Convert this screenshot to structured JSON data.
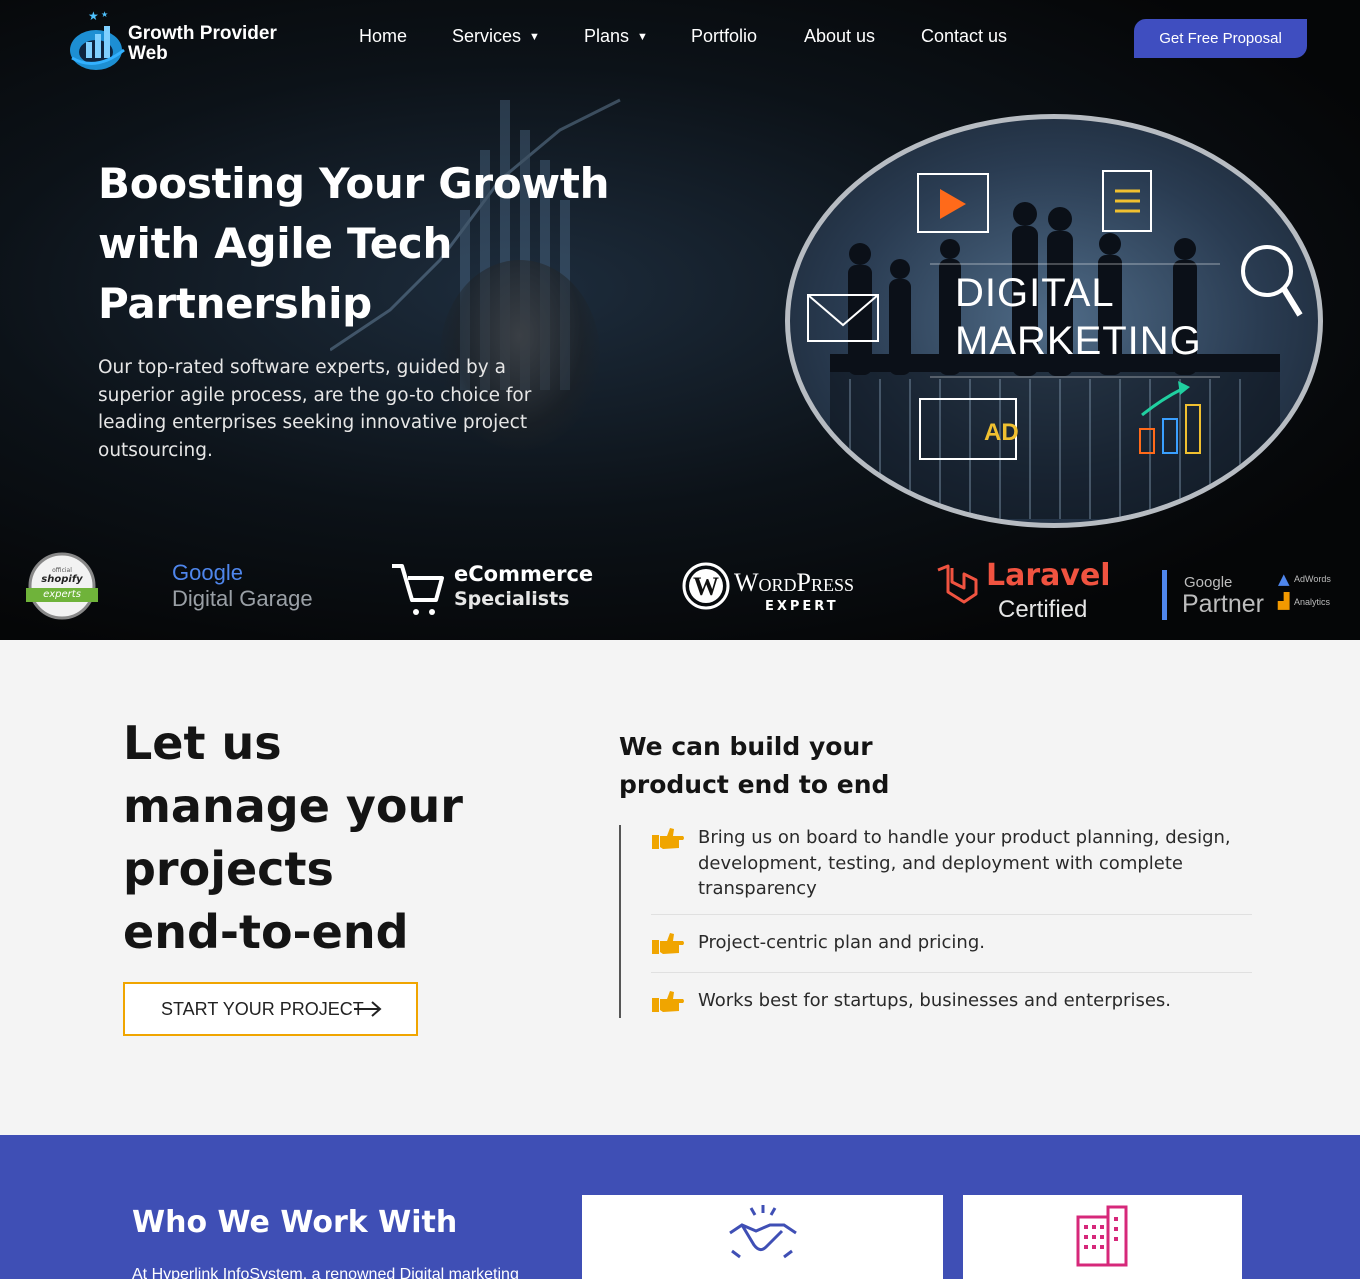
{
  "header": {
    "brand_line1": "Growth Provider",
    "brand_line2": "Web",
    "nav": [
      {
        "label": "Home",
        "has_dropdown": false
      },
      {
        "label": "Services",
        "has_dropdown": true
      },
      {
        "label": "Plans",
        "has_dropdown": true
      },
      {
        "label": "Portfolio",
        "has_dropdown": false
      },
      {
        "label": "About us",
        "has_dropdown": false
      },
      {
        "label": "Contact us",
        "has_dropdown": false
      }
    ],
    "cta_label": "Get Free Proposal",
    "cta_color": "#3f4ec0"
  },
  "hero": {
    "title_line1": "Boosting Your Growth",
    "title_line2": "with Agile Tech",
    "title_line3": "Partnership",
    "subtitle": "Our top-rated software experts, guided by a superior agile process, are the go-to choice for leading enterprises seeking innovative project outsourcing.",
    "graphic": {
      "line1": "DIGITAL",
      "line2": "MARKETING",
      "ad_label": "AD"
    }
  },
  "partners": {
    "shopify_small": "official",
    "shopify_name": "shopify",
    "shopify_ribbon": "experts",
    "google_garage_1": "Google",
    "google_garage_2": "Digital Garage",
    "ecommerce_1": "eCommerce",
    "ecommerce_2": "Specialists",
    "wordpress_1": "WordPress",
    "wordpress_2": "EXPERT",
    "laravel_1": "Laravel",
    "laravel_2": "Certified",
    "gpartner_1": "Google",
    "gpartner_2": "Partner",
    "gpartner_3": "AdWords",
    "gpartner_4": "Analytics"
  },
  "intro": {
    "heading_lines": [
      "Let us",
      "manage your",
      "projects",
      "end-to-end"
    ],
    "button_label": "START YOUR PROJECT",
    "button_border_color": "#f0a500",
    "subheading_line1": "We can build your",
    "subheading_line2": "product end to end",
    "features": [
      "Bring us on board to handle your product planning, design, development, testing, and deployment with complete transparency",
      "Project-centric plan and pricing.",
      "Works best for startups, businesses and enterprises."
    ],
    "feature_icon": "pointing-hand-icon",
    "feature_icon_color": "#f0a500"
  },
  "who": {
    "title": "Who We Work With",
    "description": "At Hyperlink InfoSystem, a renowned Digital marketing",
    "background": "#3f4fb5",
    "cards": [
      "handshake-icon",
      "building-icon"
    ]
  }
}
